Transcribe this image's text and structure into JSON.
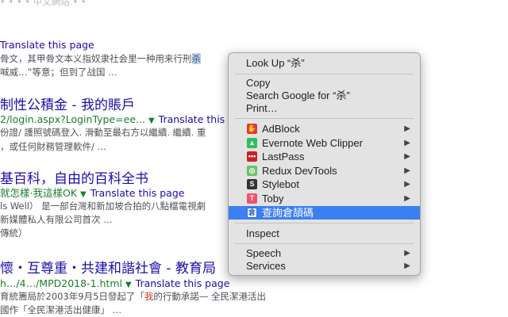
{
  "results": {
    "top_partial": "• • • • 中文網站 • •",
    "r0": {
      "translate": "Translate this page"
    },
    "r0_snip1_a": "骨文，其甲骨文本义指奴隶社会里一种用来行刑",
    "r0_snip1_hl": "杀",
    "r0_snip2": "喊威…”等意；但到了战国 …",
    "r1": {
      "title": "制性公積金 - 我的賬戶",
      "url": "2/login.aspx?LoginType=ee...",
      "translate": "Translate this pa",
      "snip1": "份證/ 護照號碼登入. 滑動至最右方以繼續. 繼續. 重",
      "snip2": "，或任何財務管理軟件/ …"
    },
    "r2": {
      "title": "基百科，自由的百科全书",
      "url": "就怎樣·我這樣OK",
      "translate": "Translate this page",
      "snip1": "ls Well） 是一部台灣和新加坡合拍的八點檔電視劇",
      "snip2": "新媒體私人有限公司首次 …",
      "snip3": "傳統）"
    },
    "r3": {
      "title": "懷・互尊重・共建和諧社會 - 教育局",
      "url": "h…/4…/MPD2018-1.html",
      "translate": "Translate this page",
      "snip1_a": "育統籌局於2003年9月5日發起了「",
      "snip1_red": "我",
      "snip1_b": "的行動承諾— 全民潔港活出",
      "snip2": "國作「全民潔港活出健康」 …"
    }
  },
  "menu": {
    "look_up": "Look Up “杀”",
    "copy": "Copy",
    "search_google": "Search Google for “杀”",
    "print": "Print…",
    "extensions": [
      {
        "label": "AdBlock",
        "icon": "adblock-icon",
        "color": "#e03a2f",
        "glyph": "✋",
        "submenu": true
      },
      {
        "label": "Evernote Web Clipper",
        "icon": "evernote-icon",
        "color": "#2dbe60",
        "glyph": "▲",
        "submenu": true
      },
      {
        "label": "LastPass",
        "icon": "lastpass-icon",
        "color": "#cc2029",
        "glyph": "•••",
        "submenu": true
      },
      {
        "label": "Redux DevTools",
        "icon": "redux-devtools-icon",
        "color": "#6cbf6c",
        "glyph": "◎",
        "submenu": true
      },
      {
        "label": "Stylebot",
        "icon": "stylebot-icon",
        "color": "#333333",
        "glyph": "S",
        "submenu": true
      },
      {
        "label": "Toby",
        "icon": "toby-icon",
        "color": "#f0506e",
        "glyph": "T",
        "submenu": true
      },
      {
        "label": "查詢倉頡碼",
        "icon": "cangjie-lookup-icon",
        "color": "#ffffff",
        "glyph": "倉",
        "submenu": false,
        "selected": true
      }
    ],
    "inspect": "Inspect",
    "speech": "Speech",
    "services": "Services",
    "arrow": "▶"
  }
}
